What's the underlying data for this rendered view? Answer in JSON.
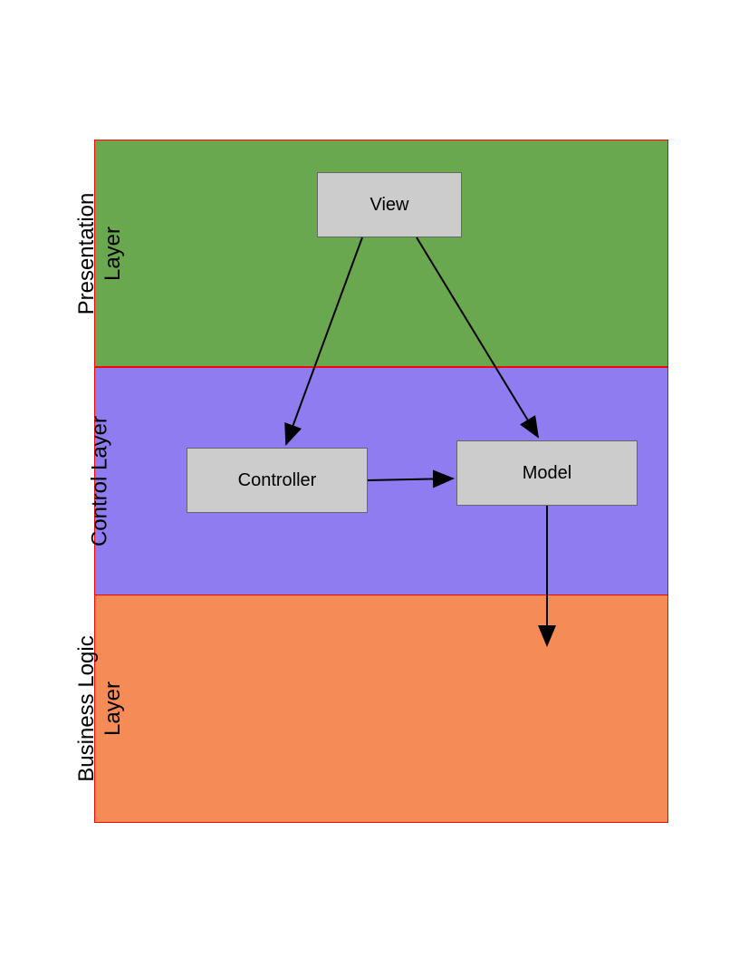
{
  "diagram": {
    "layers": [
      {
        "id": "presentation",
        "label": "Presentation\nLayer",
        "color": "#6aa84f"
      },
      {
        "id": "control",
        "label": "Control Layer",
        "color": "#8e7cf0"
      },
      {
        "id": "business",
        "label": "Business Logic\nLayer",
        "color": "#f58b56"
      }
    ],
    "nodes": {
      "view": {
        "label": "View",
        "layer": "presentation"
      },
      "controller": {
        "label": "Controller",
        "layer": "control"
      },
      "model": {
        "label": "Model",
        "layer": "control"
      }
    },
    "edges": [
      {
        "from": "view",
        "to": "controller"
      },
      {
        "from": "view",
        "to": "model"
      },
      {
        "from": "controller",
        "to": "model"
      },
      {
        "from": "model",
        "to": "business"
      }
    ]
  }
}
